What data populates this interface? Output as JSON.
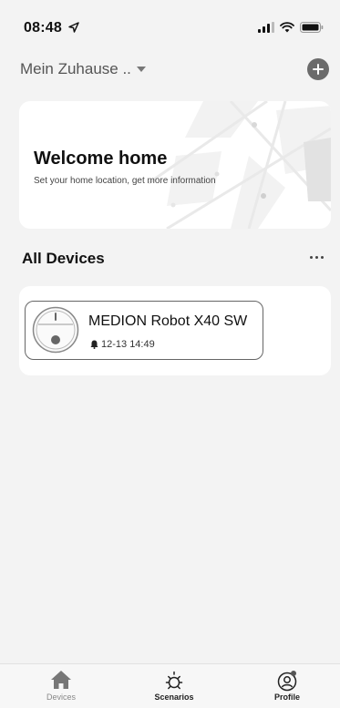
{
  "status_bar": {
    "time": "08:48"
  },
  "header": {
    "home_name": "Mein Zuhause .."
  },
  "welcome": {
    "title": "Welcome home",
    "subtitle": "Set your home location, get more information"
  },
  "section": {
    "title": "All Devices"
  },
  "devices": [
    {
      "name": "MEDION Robot X40 SW",
      "last_event": "12-13 14:49"
    }
  ],
  "tabs": [
    {
      "label": "Devices",
      "icon": "home-icon",
      "active": true
    },
    {
      "label": "Scenarios",
      "icon": "sun-icon",
      "active": false
    },
    {
      "label": "Profile",
      "icon": "profile-icon",
      "active": false
    }
  ],
  "colors": {
    "accent_icon": "#6b6b6b",
    "background": "#f3f3f3",
    "card": "#ffffff"
  }
}
